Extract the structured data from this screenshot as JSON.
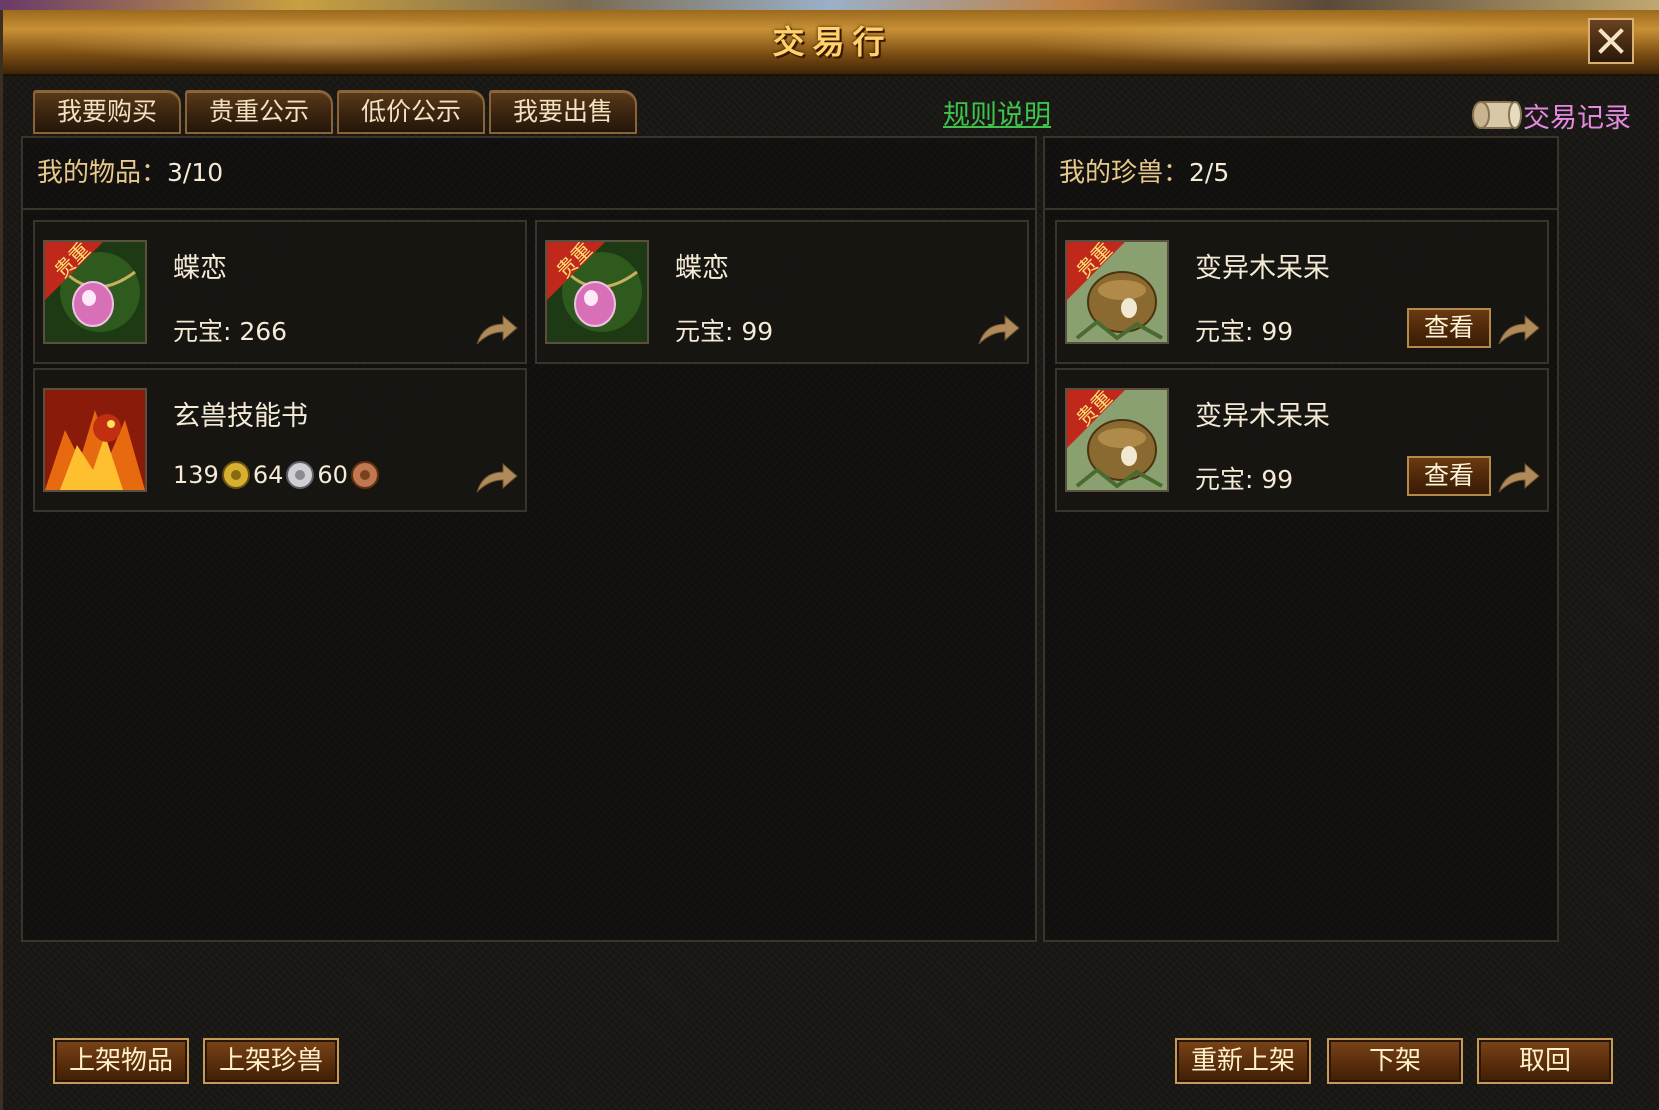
{
  "window": {
    "title": "交易行",
    "close_label": "✕"
  },
  "tabs": [
    {
      "label": "我要购买"
    },
    {
      "label": "贵重公示"
    },
    {
      "label": "低价公示"
    },
    {
      "label": "我要出售"
    }
  ],
  "rules_link": "规则说明",
  "record_link": "交易记录",
  "my_items": {
    "label": "我的物品：",
    "count": "3/10",
    "cards": [
      {
        "name": "蝶恋",
        "price": "元宝:  266",
        "badge": "贵重",
        "icon": "pink-gem-pendant-icon"
      },
      {
        "name": "蝶恋",
        "price": "元宝:  99",
        "badge": "贵重",
        "icon": "pink-gem-pendant-icon"
      },
      {
        "name": "玄兽技能书",
        "coins": [
          {
            "amount": "139",
            "type": "gold"
          },
          {
            "amount": "64",
            "type": "silver"
          },
          {
            "amount": "60",
            "type": "copper"
          }
        ],
        "icon": "fire-beast-book-icon"
      }
    ]
  },
  "my_pets": {
    "label": "我的珍兽：",
    "count": "2/5",
    "cards": [
      {
        "name": "变异木呆呆",
        "price": "元宝:  99",
        "badge": "贵重",
        "view_label": "查看",
        "icon": "tree-stump-pet-icon"
      },
      {
        "name": "变异木呆呆",
        "price": "元宝:  99",
        "badge": "贵重",
        "view_label": "查看",
        "icon": "tree-stump-pet-icon"
      }
    ]
  },
  "bottom_buttons": {
    "list_item": "上架物品",
    "list_pet": "上架珍兽",
    "relist": "重新上架",
    "delist": "下架",
    "retrieve": "取回"
  },
  "colors": {
    "accent_gold": "#ffd36a",
    "rules_green": "#3ec44a",
    "record_pink": "#e68ae0",
    "badge_red": "#c0281c"
  }
}
